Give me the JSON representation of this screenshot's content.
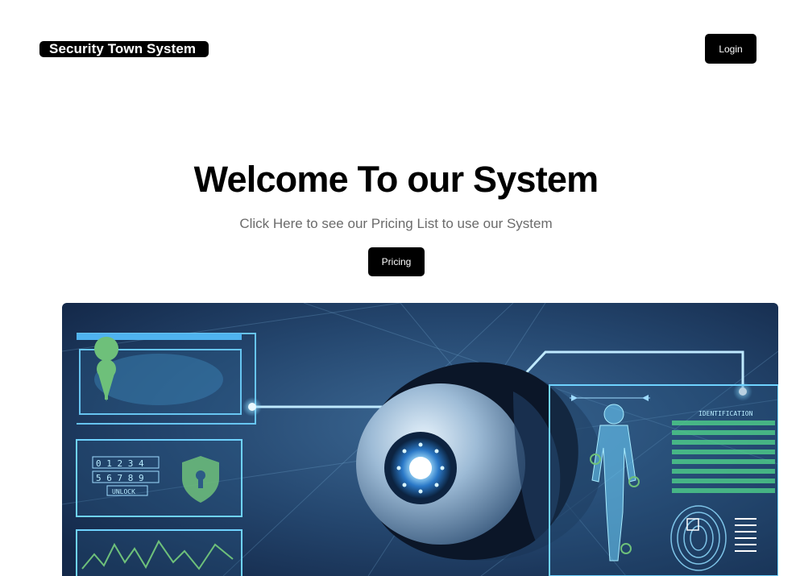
{
  "header": {
    "brand": "Security Town System",
    "login_label": "Login"
  },
  "hero": {
    "title": "Welcome To our System",
    "subtitle": "Click Here to see our Pricing List to use our System",
    "pricing_label": "Pricing"
  },
  "image": {
    "subject": "security-camera-illustration",
    "panel_keypad_row1": "0 1 2 3 4",
    "panel_keypad_row2": "5 6 7 8 9",
    "panel_unlock": "UNLOCK",
    "panel_identification": "IDENTIFICATION"
  },
  "colors": {
    "button_bg": "#000000",
    "button_text": "#ffffff",
    "subtitle": "#6b6b6b",
    "image_bg": "#1f3a5c",
    "image_accent": "#6fd3ff"
  }
}
